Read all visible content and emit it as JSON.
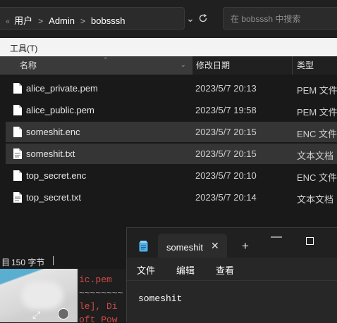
{
  "explorer": {
    "breadcrumb": {
      "back_glyph": "«",
      "items": [
        "用户",
        "Admin",
        "bobsssh"
      ]
    },
    "search": {
      "placeholder": "在 bobsssh 中搜索"
    },
    "menu": {
      "tools": "工具(T)"
    },
    "columns": {
      "name": "名称",
      "date": "修改日期",
      "type": "类型"
    },
    "files": [
      {
        "name": "alice_private.pem",
        "date": "2023/5/7 20:13",
        "type": "PEM 文件",
        "selected": false
      },
      {
        "name": "alice_public.pem",
        "date": "2023/5/7 19:58",
        "type": "PEM 文件",
        "selected": false
      },
      {
        "name": "someshit.enc",
        "date": "2023/5/7 20:15",
        "type": "ENC 文件",
        "selected": true
      },
      {
        "name": "someshit.txt",
        "date": "2023/5/7 20:15",
        "type": "文本文档",
        "selected": true
      },
      {
        "name": "top_secret.enc",
        "date": "2023/5/7 20:10",
        "type": "ENC 文件",
        "selected": false
      },
      {
        "name": "top_secret.txt",
        "date": "2023/5/7 20:14",
        "type": "文本文档",
        "selected": false
      }
    ],
    "status": {
      "items_label": "目",
      "size": "150 字节"
    }
  },
  "background_window": {
    "code_lines": [
      "ic.pem",
      "~~~~~~~~",
      "le], Di",
      "oft Pow"
    ]
  },
  "notepad": {
    "tab_title": "someshit",
    "menu": {
      "file": "文件",
      "edit": "编辑",
      "view": "查看"
    },
    "content": "someshit"
  },
  "colors": {
    "background": "#191919",
    "toolbar_light": "#f3f3f3",
    "selection": "#353535",
    "notepad_icon": "#4fb0e8"
  }
}
